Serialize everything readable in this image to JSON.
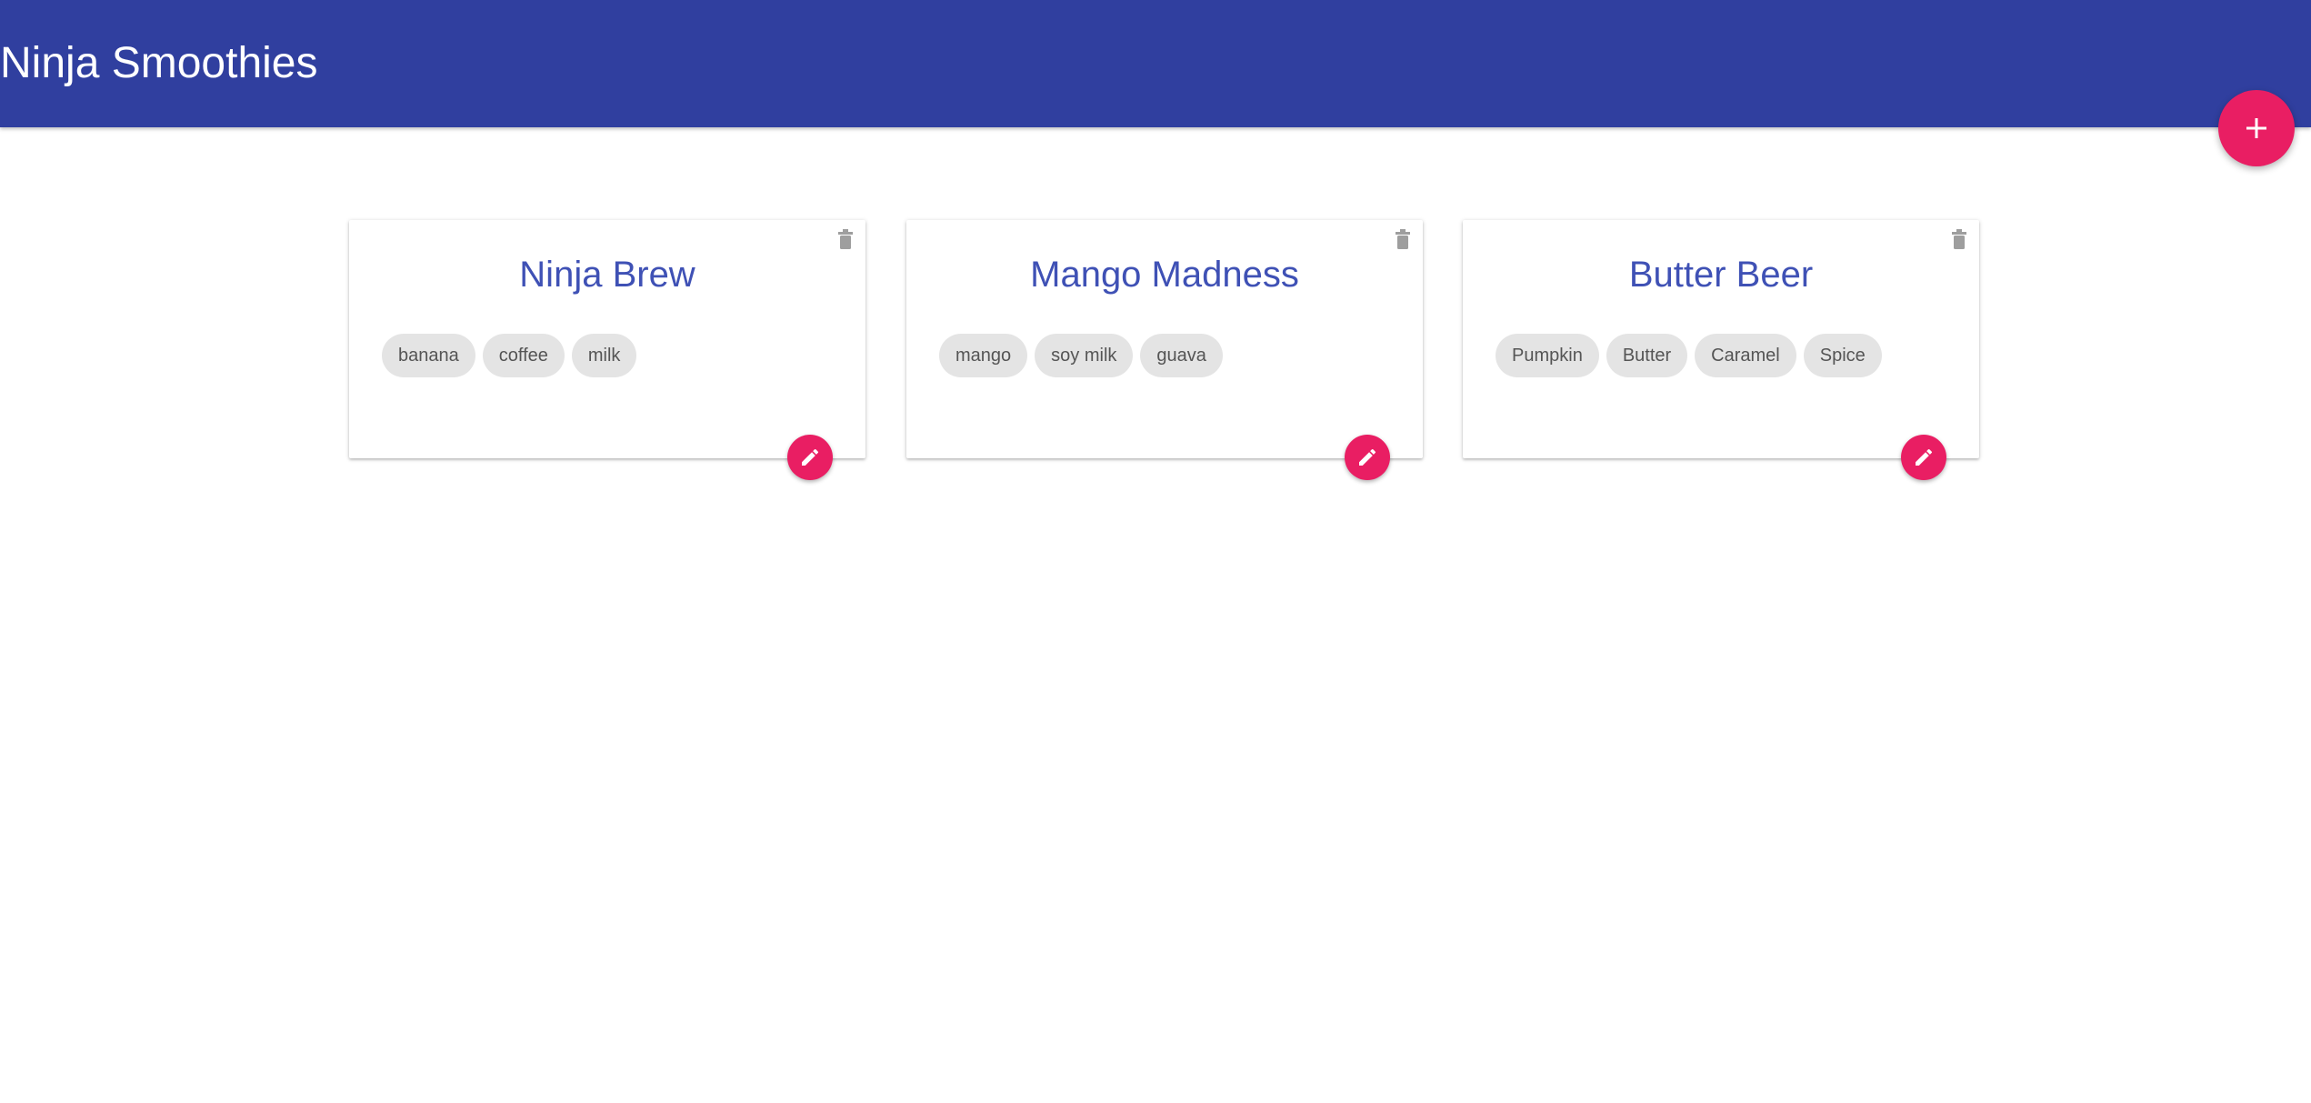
{
  "navbar": {
    "brand": "Ninja Smoothies",
    "color": "#303f9f",
    "add_icon": "plus-icon"
  },
  "accent_color": "#e91e63",
  "title_color": "#3f51b5",
  "smoothies": [
    {
      "title": "Ninja Brew",
      "ingredients": [
        "banana",
        "coffee",
        "milk"
      ]
    },
    {
      "title": "Mango Madness",
      "ingredients": [
        "mango",
        "soy milk",
        "guava"
      ]
    },
    {
      "title": "Butter Beer",
      "ingredients": [
        "Pumpkin",
        "Butter",
        "Caramel",
        "Spice"
      ]
    }
  ],
  "icons": {
    "delete": "delete-icon",
    "edit": "edit-icon"
  }
}
